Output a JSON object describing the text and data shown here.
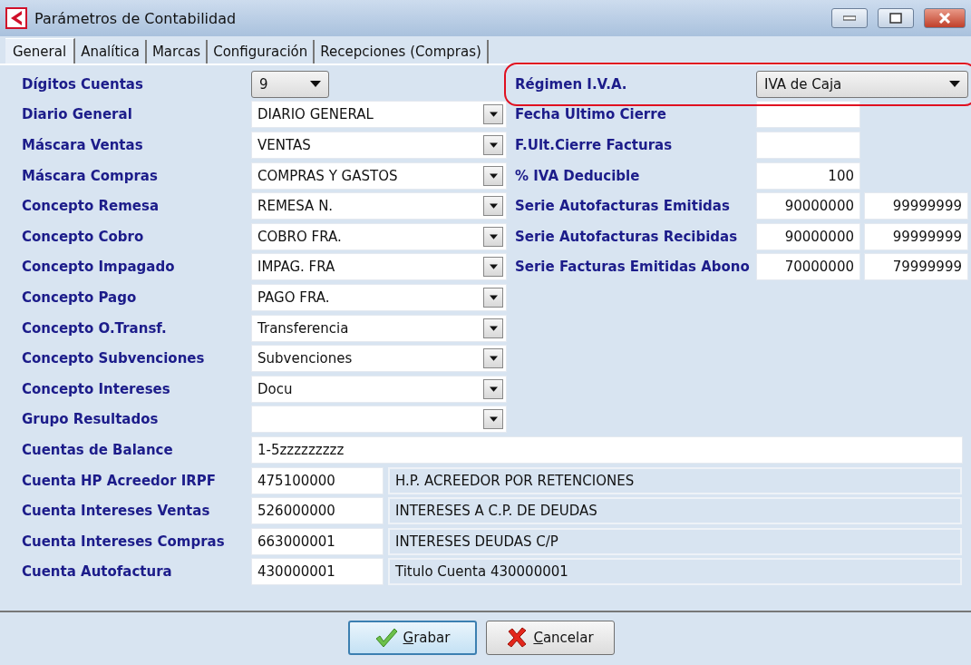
{
  "window": {
    "title": "Parámetros de Contabilidad"
  },
  "tabs": [
    {
      "label": "General",
      "selected": true
    },
    {
      "label": "Analítica",
      "selected": false
    },
    {
      "label": "Marcas",
      "selected": false
    },
    {
      "label": "Configuración",
      "selected": false
    },
    {
      "label": "Recepciones (Compras)",
      "selected": false
    }
  ],
  "left_fields": [
    {
      "label": "Dígitos Cuentas",
      "kind": "dropdown",
      "value": "9"
    },
    {
      "label": "Diario General",
      "kind": "combo",
      "value": "DIARIO GENERAL"
    },
    {
      "label": "Máscara Ventas",
      "kind": "combo",
      "value": "VENTAS"
    },
    {
      "label": "Máscara Compras",
      "kind": "combo",
      "value": "COMPRAS Y GASTOS"
    },
    {
      "label": "Concepto Remesa",
      "kind": "combo",
      "value": "REMESA N."
    },
    {
      "label": "Concepto Cobro",
      "kind": "combo",
      "value": "COBRO FRA."
    },
    {
      "label": "Concepto Impagado",
      "kind": "combo",
      "value": "IMPAG. FRA"
    },
    {
      "label": "Concepto Pago",
      "kind": "combo",
      "value": "PAGO FRA."
    },
    {
      "label": "Concepto O.Transf.",
      "kind": "combo",
      "value": "Transferencia"
    },
    {
      "label": "Concepto Subvenciones",
      "kind": "combo",
      "value": "Subvenciones"
    },
    {
      "label": "Concepto Intereses",
      "kind": "combo",
      "value": "Docu"
    },
    {
      "label": "Grupo Resultados",
      "kind": "combo"
    }
  ],
  "right_fields": [
    {
      "label": "Régimen I.V.A.",
      "kind": "dropdown",
      "value": "IVA de Caja",
      "highlighted": true
    },
    {
      "label": "Fecha Ultimo Cierre",
      "kind": "text"
    },
    {
      "label": "F.Ult.Cierre Facturas",
      "kind": "text"
    },
    {
      "label": "% IVA Deducible",
      "kind": "text",
      "value": "100"
    },
    {
      "label": "Serie Autofacturas Emitidas",
      "kind": "range",
      "from": "90000000",
      "to": "99999999"
    },
    {
      "label": "Serie Autofacturas Recibidas",
      "kind": "range",
      "from": "90000000",
      "to": "99999999"
    },
    {
      "label": "Serie Facturas Emitidas Abono",
      "kind": "range",
      "from": "70000000",
      "to": "79999999"
    }
  ],
  "balance": {
    "label": "Cuentas de Balance",
    "value": "1-5zzzzzzzzz"
  },
  "accounts": [
    {
      "label": "Cuenta HP Acreedor IRPF",
      "code": "475100000",
      "description": "H.P. ACREEDOR POR RETENCIONES"
    },
    {
      "label": "Cuenta Intereses Ventas",
      "code": "526000000",
      "description": "INTERESES A C.P. DE DEUDAS"
    },
    {
      "label": "Cuenta Intereses Compras",
      "code": "663000001",
      "description": "INTERESES DEUDAS C/P"
    },
    {
      "label": "Cuenta Autofactura",
      "code": "430000001",
      "description": "Titulo Cuenta 430000001"
    }
  ],
  "buttons": [
    {
      "label": "Grabar",
      "kind": "save",
      "focused": true
    },
    {
      "label": "Cancelar",
      "kind": "cancel",
      "focused": false
    }
  ]
}
